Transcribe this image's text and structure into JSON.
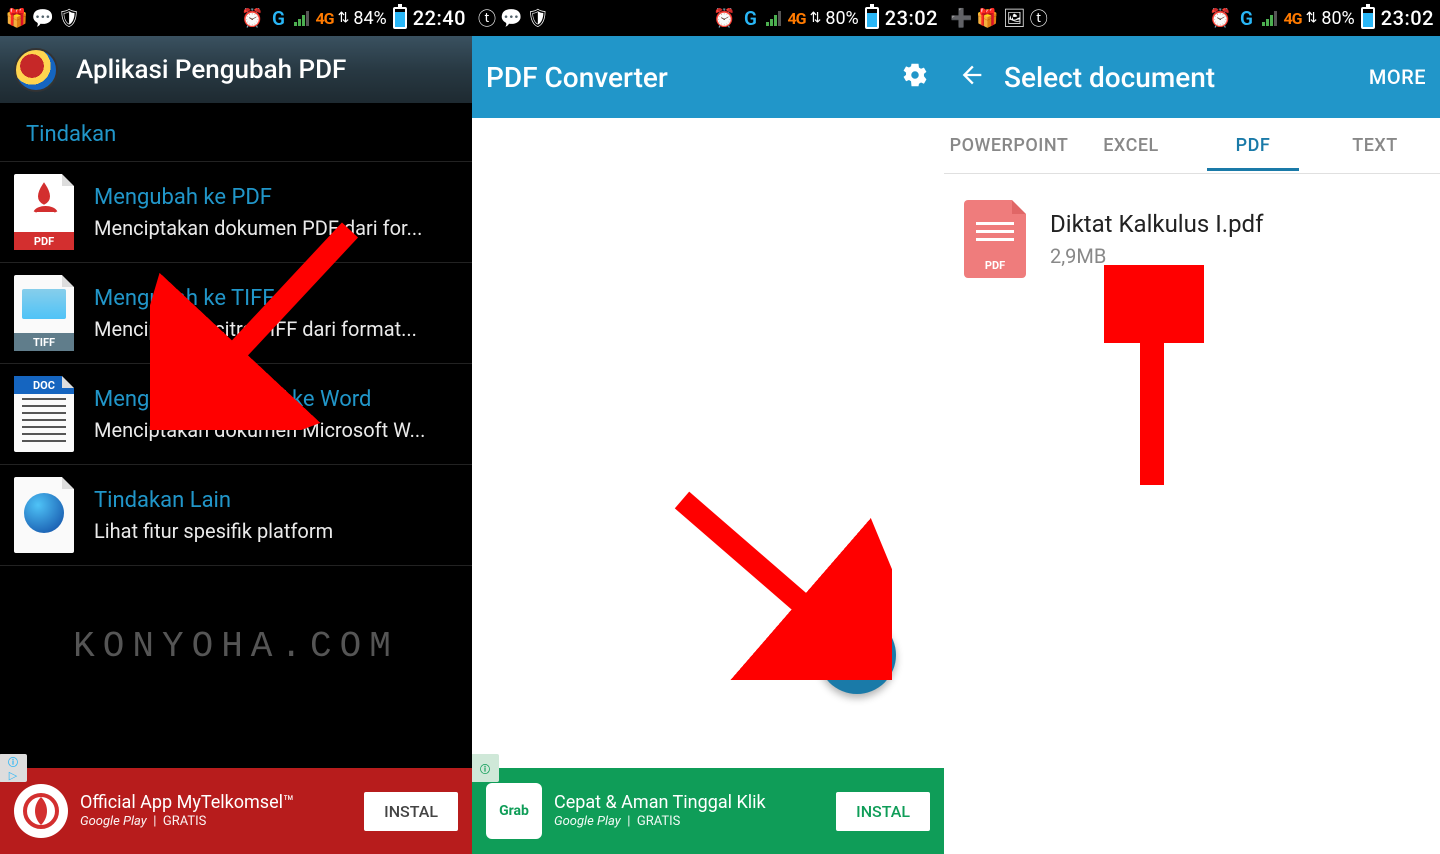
{
  "col1": {
    "status": {
      "battery_pct": "84%",
      "time": "22:40",
      "net": "4G",
      "battery_fill": 84
    },
    "app_title": "Aplikasi Pengubah PDF",
    "section_label": "Tindakan",
    "actions": [
      {
        "title": "Mengubah ke PDF",
        "sub": "Menciptakan dokumen PDF dari for...",
        "badge": "PDF",
        "badge_bg": "#d32f2f",
        "body": "#fff",
        "glyph": "pdf"
      },
      {
        "title": "Mengubah ke TIFF",
        "sub": "Menciptakan citra TIFF dari format...",
        "badge": "TIFF",
        "badge_bg": "#607d8b",
        "body": "#fafafa",
        "glyph": "tiff"
      },
      {
        "title": "Mengubah dari PDF ke Word",
        "sub": "Menciptakan dokumen Microsoft W...",
        "badge": "DOC",
        "badge_bg": "#1565c0",
        "body": "#fafafa",
        "glyph": "doc",
        "badge_top": true
      },
      {
        "title": "Tindakan Lain",
        "sub": "Lihat fitur spesifik platform",
        "badge": "",
        "badge_bg": "transparent",
        "body": "#fafafa",
        "glyph": "globe"
      }
    ],
    "watermark": "KONYOHA.COM",
    "ad": {
      "headline": "Official App MyTelkomsel™",
      "sub1": "Google Play",
      "sub2": "GRATIS",
      "button": "INSTAL"
    }
  },
  "col2": {
    "status": {
      "battery_pct": "80%",
      "time": "23:02",
      "net": "4G",
      "battery_fill": 80
    },
    "app_title": "PDF Converter",
    "fab_label": "+",
    "ad": {
      "brand": "Grab",
      "headline": "Cepat & Aman Tinggal Klik",
      "sub1": "Google Play",
      "sub2": "GRATIS",
      "button": "INSTAL"
    }
  },
  "col3": {
    "status": {
      "battery_pct": "80%",
      "time": "23:02",
      "net": "4G",
      "battery_fill": 80
    },
    "app_title": "Select document",
    "more_label": "MORE",
    "tabs": [
      "POWERPOINT",
      "EXCEL",
      "PDF",
      "TEXT"
    ],
    "active_tab_index": 2,
    "file": {
      "name": "Diktat Kalkulus I.pdf",
      "size": "2,9MB",
      "badge": "PDF"
    }
  }
}
